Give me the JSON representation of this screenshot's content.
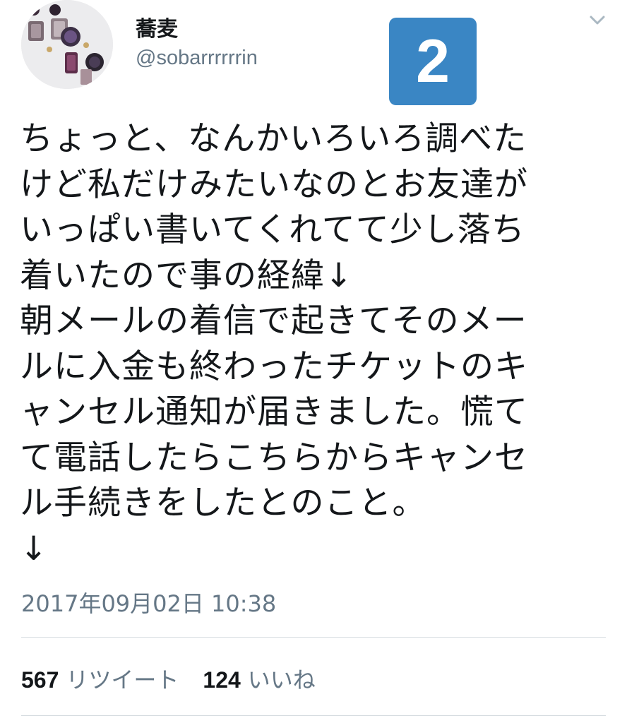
{
  "user": {
    "display_name": "蕎麦",
    "handle": "@sobarrrrrrin",
    "avatar_icon": "avatar-earrings-photo"
  },
  "badge": {
    "number": "2",
    "color": "#3a86c4"
  },
  "tweet": {
    "lines": [
      "ちょっと、なんかいろいろ調べた",
      "けど私だけみたいなのとお友達が",
      "いっぱい書いてくれてて少し落ち",
      "着いたので事の経緯↓",
      "朝メールの着信で起きてそのメー",
      "ルに入金も終わったチケットのキ",
      "ャンセル通知が届きました。慌て",
      "て電話したらこちらからキャンセ",
      "ル手続きをしたとのこと。",
      "↓"
    ],
    "timestamp": "2017年09月02日 10:38"
  },
  "stats": {
    "retweets_count": "567",
    "retweets_label": "リツイート",
    "likes_count": "124",
    "likes_label": "いいね"
  },
  "icons": {
    "menu": "chevron-down-icon"
  },
  "colors": {
    "text": "#14171a",
    "secondary": "#657786",
    "divider": "#d6dce0"
  }
}
